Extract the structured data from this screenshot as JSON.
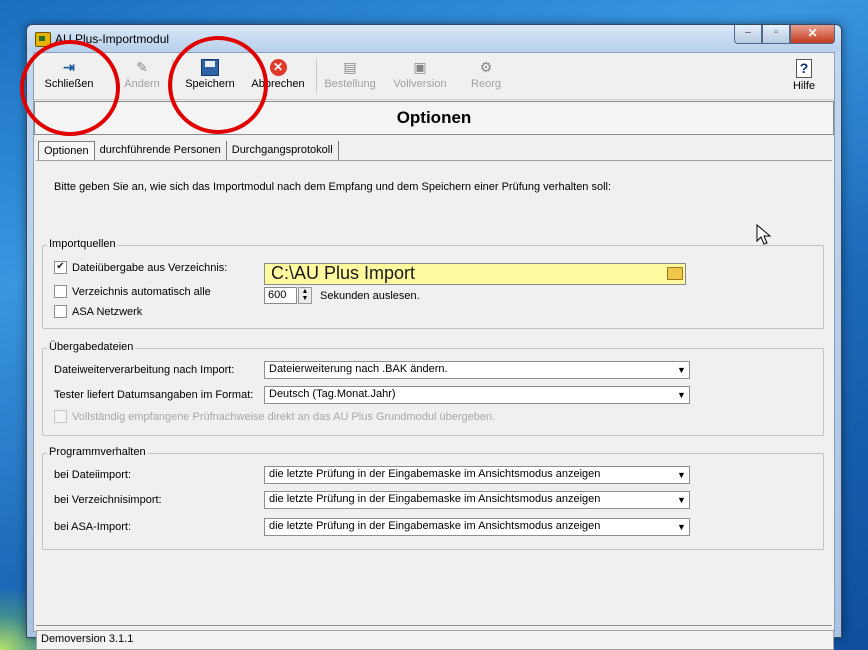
{
  "window": {
    "title": "AU Plus-Importmodul"
  },
  "toolbar": {
    "buttons": [
      {
        "label": "Schließen",
        "icon": "exit-door-icon",
        "enabled": true
      },
      {
        "label": "Ändern",
        "icon": "edit-icon",
        "enabled": false
      },
      {
        "label": "Speichern",
        "icon": "floppy-disk-icon",
        "enabled": true
      },
      {
        "label": "Abbrechen",
        "icon": "cancel-icon",
        "enabled": true
      },
      {
        "label": "Bestellung",
        "icon": "order-icon",
        "enabled": false
      },
      {
        "label": "Vollversion",
        "icon": "floppy-disk-icon",
        "enabled": false
      },
      {
        "label": "Reorg",
        "icon": "reorg-icon",
        "enabled": false
      },
      {
        "label": "Hilfe",
        "icon": "help-icon",
        "enabled": true
      }
    ]
  },
  "header": {
    "title": "Optionen"
  },
  "tabs": [
    "Optionen",
    "durchführende Personen",
    "Durchgangsprotokoll"
  ],
  "intro": "Bitte geben Sie an, wie sich das Importmodul nach dem Empfang und dem Speichern einer Prüfung verhalten soll:",
  "importquellen": {
    "legend": "Importquellen",
    "dir_transfer": {
      "label": "Dateiübergabe aus Verzeichnis:",
      "checked": true
    },
    "path": "C:\\AU Plus Import",
    "auto_dir": {
      "label": "Verzeichnis automatisch alle",
      "checked": false
    },
    "seconds": "600",
    "seconds_suffix": "Sekunden auslesen.",
    "asa": {
      "label": "ASA Netzwerk",
      "checked": false
    }
  },
  "uebergabe": {
    "legend": "Übergabedateien",
    "rows": [
      {
        "label": "Dateiweiterverarbeitung nach Import:",
        "value": "Dateierweiterung nach .BAK ändern."
      },
      {
        "label": "Tester liefert Datumsangaben im Format:",
        "value": "Deutsch (Tag.Monat.Jahr)"
      }
    ],
    "full_transfer": {
      "label": "Vollständig empfangene Prüfnachweise direkt an das AU Plus Grundmodul übergeben.",
      "checked": false,
      "enabled": false
    }
  },
  "programm": {
    "legend": "Programmverhalten",
    "rows": [
      {
        "label": "bei Dateiimport:",
        "value": "die letzte Prüfung in der Eingabemaske im Ansichtsmodus anzeigen"
      },
      {
        "label": "bei Verzeichnisimport:",
        "value": "die letzte Prüfung in der Eingabemaske im Ansichtsmodus anzeigen"
      },
      {
        "label": "bei ASA-Import:",
        "value": "die letzte Prüfung in der Eingabemaske im Ansichtsmodus anzeigen"
      }
    ]
  },
  "status": {
    "text": "Demoversion 3.1.1"
  },
  "colors": {
    "highlight_circle": "#e00000",
    "path_field_bg": "#fff9a0"
  }
}
